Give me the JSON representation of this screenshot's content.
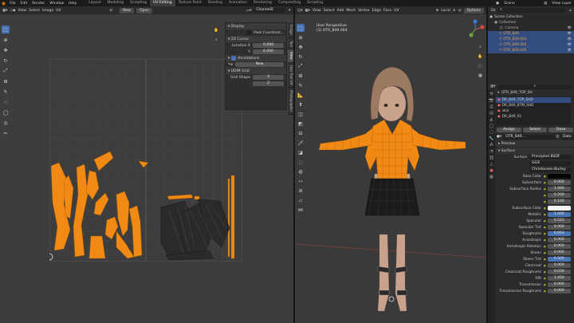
{
  "topbar": {
    "menus": [
      "File",
      "Edit",
      "Render",
      "Window",
      "Help"
    ],
    "workspaces": [
      "Layout",
      "Modeling",
      "Sculpting",
      "UV Editing",
      "Texture Paint",
      "Shading",
      "Animation",
      "Rendering",
      "Compositing",
      "Scripting"
    ],
    "active_workspace": "UV Editing",
    "scene_label": "Scene",
    "view_layer_label": "View Layer"
  },
  "uv_editor": {
    "menus": [
      "View",
      "Select",
      "Image",
      "UV"
    ],
    "new_label": "New",
    "open_label": "Open",
    "image_name": "Channel0",
    "tabs": [
      "Image",
      "Tool",
      "View",
      "Hair Tool UV",
      "Photographer"
    ],
    "active_tab": "View",
    "display_header": "Display",
    "pixel_coords_label": "Pixel Coordinat...",
    "cursor_header": "2D Cursor",
    "cursor_label": "Location X",
    "cursor_x": "0.000",
    "cursor_y_label": "Y",
    "cursor_y": "0.000",
    "annotations_header": "Annotations",
    "annotations_new": "New",
    "udim_header": "UDIM Grid",
    "grid_shape_label": "Grid Shape",
    "grid_x": "3",
    "grid_y": "2"
  },
  "viewport": {
    "menus": [
      "View",
      "Select",
      "Add",
      "Mesh",
      "Vertex",
      "Edge",
      "Face",
      "UV"
    ],
    "orientation": "Local",
    "options_label": "Options",
    "view_name": "User Perspective",
    "object_name": "(1) OTR_B49.004"
  },
  "outliner": {
    "title": "Scene Collection",
    "items": [
      {
        "name": "Collection",
        "indent": 1,
        "sel": false,
        "color": "#bbbbbb"
      },
      {
        "name": "Camera",
        "indent": 2,
        "sel": false,
        "color": "#b0b0b0"
      },
      {
        "name": "OTR_B49",
        "indent": 2,
        "sel": true,
        "color": "#e6a04c"
      },
      {
        "name": "OTR_B49.003",
        "indent": 2,
        "sel": true,
        "color": "#e6a04c"
      },
      {
        "name": "OTR_B49.004",
        "indent": 2,
        "sel": true,
        "color": "#e6a04c"
      },
      {
        "name": "OTR_B49.005",
        "indent": 2,
        "sel": true,
        "color": "#e6a04c"
      }
    ]
  },
  "properties": {
    "active_object": "OTR_B49_TOP_SH",
    "material_slots": [
      "DR_B49_TOP_SHD",
      "DR_B49_BTM_SHD",
      "skin",
      "DR_B49_01"
    ],
    "assign_label": "Assign",
    "select_label": "Select",
    "deselect_label": "Dese",
    "material_name": "OTR_B49...",
    "data_label": "Data",
    "preview_label": "Preview",
    "surface_header": "Surface",
    "surface_label": "Surface",
    "surface_value": "Principled BSDF",
    "distribution": "GGX",
    "subsurface_method": "Christensen-Burley",
    "fields": [
      {
        "label": "Base Color",
        "value": "",
        "kind": "color"
      },
      {
        "label": "Subsurface",
        "value": "0.000",
        "kind": "num"
      },
      {
        "label": "Subsurface Radius",
        "value": "1.000",
        "kind": "num"
      },
      {
        "label": "",
        "value": "0.200",
        "kind": "num"
      },
      {
        "label": "",
        "value": "0.100",
        "kind": "num"
      },
      {
        "label": "Subsurface Color",
        "value": "",
        "kind": "white"
      },
      {
        "label": "Metallic",
        "value": "1.000",
        "kind": "blue"
      },
      {
        "label": "Specular",
        "value": "0.522",
        "kind": "num"
      },
      {
        "label": "Specular Tint",
        "value": "0.000",
        "kind": "num"
      },
      {
        "label": "Roughness",
        "value": "0.663",
        "kind": "blue"
      },
      {
        "label": "Anisotropic",
        "value": "0.000",
        "kind": "num"
      },
      {
        "label": "Anisotropic Rotation",
        "value": "0.000",
        "kind": "num"
      },
      {
        "label": "Sheen",
        "value": "0.000",
        "kind": "num"
      },
      {
        "label": "Sheen Tint",
        "value": "0.500",
        "kind": "blue"
      },
      {
        "label": "Clearcoat",
        "value": "0.000",
        "kind": "num"
      },
      {
        "label": "Clearcoat Roughness",
        "value": "0.030",
        "kind": "num"
      },
      {
        "label": "IOR",
        "value": "1.450",
        "kind": "num"
      },
      {
        "label": "Transmission",
        "value": "0.000",
        "kind": "num"
      },
      {
        "label": "Transmission Roughness",
        "value": "0.000",
        "kind": "num"
      }
    ]
  },
  "colors": {
    "accent": "#e87d0d",
    "selected": "#4772b3",
    "uv_orange": "#f08a14"
  }
}
